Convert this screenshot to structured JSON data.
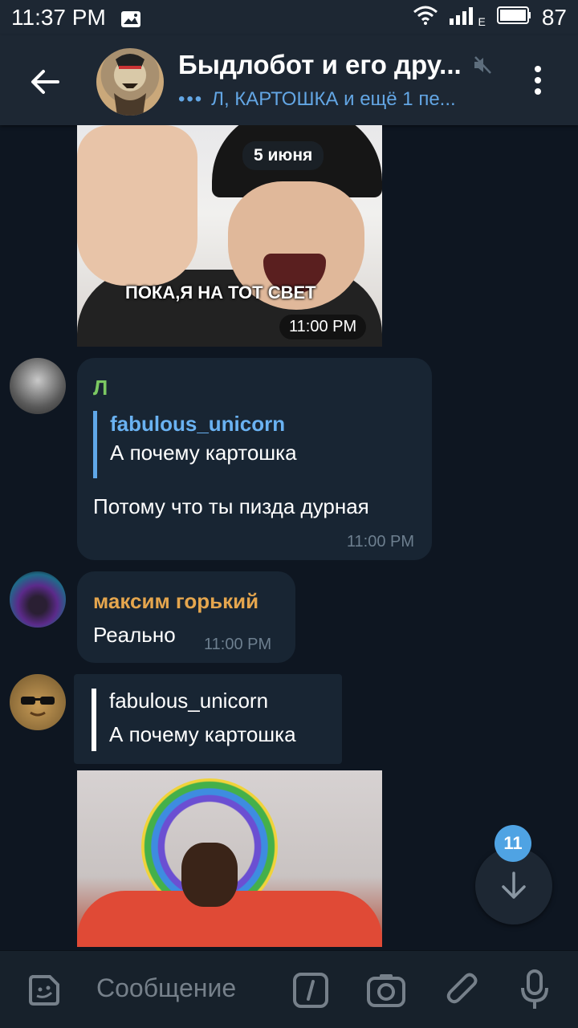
{
  "status_bar": {
    "time": "11:37 PM",
    "battery": "87",
    "network_tag": "E",
    "icons": [
      "image-icon",
      "wifi-icon",
      "signal-icon",
      "battery-icon"
    ]
  },
  "header": {
    "title": "Быдлобот и его дру...",
    "subtitle": "Л, КАРТОШКА и ещё 1 пе...",
    "typing_dots": "•••"
  },
  "messages": [
    {
      "type": "photo",
      "caption_in_image": "ПОКА,Я НА ТОТ СВЕТ",
      "time": "11:00 PM",
      "date_pill": "5 июня"
    },
    {
      "type": "text",
      "sender": "Л",
      "sender_color": "#7bc862",
      "reply_to": {
        "name": "fabulous_unicorn",
        "text": "А почему картошка"
      },
      "text": "Потому что ты пизда дурная",
      "time": "11:00 PM"
    },
    {
      "type": "text",
      "sender": "максим горький",
      "sender_color": "#e5a64e",
      "text": "Реально",
      "time": "11:00 PM"
    },
    {
      "type": "reply_photo",
      "reply_to": {
        "name": "fabulous_unicorn",
        "text": "А почему картошка"
      }
    }
  ],
  "scroll_down": {
    "unread_count": "11"
  },
  "composer": {
    "placeholder": "Сообщение",
    "icons": [
      "sticker-icon",
      "command-icon",
      "camera-icon",
      "attach-icon",
      "mic-icon"
    ]
  },
  "colors": {
    "background": "#0e1621",
    "header": "#1d2733",
    "bubble": "#182533",
    "accent": "#4fa3e3"
  }
}
